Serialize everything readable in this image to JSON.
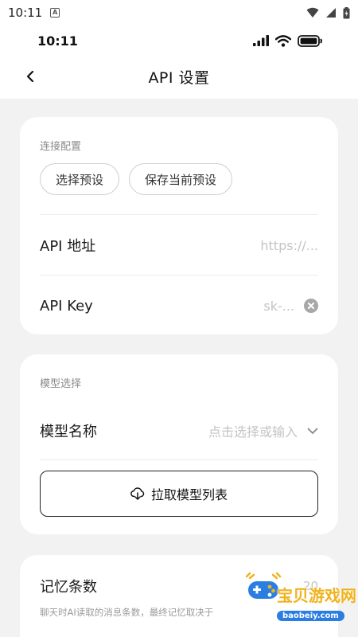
{
  "android_status": {
    "time": "10:11"
  },
  "ios_status": {
    "time": "10:11"
  },
  "header": {
    "title": "API 设置"
  },
  "connection": {
    "section_label": "连接配置",
    "preset_select_label": "选择预设",
    "preset_save_label": "保存当前预设",
    "api_url": {
      "label": "API 地址",
      "placeholder": "https://..."
    },
    "api_key": {
      "label": "API Key",
      "placeholder": "sk-..."
    }
  },
  "model": {
    "section_label": "模型选择",
    "name_label": "模型名称",
    "name_placeholder": "点击选择或输入",
    "fetch_button_label": "拉取模型列表"
  },
  "memory": {
    "title": "记忆条数",
    "description": "聊天时AI读取的消息条数，最终记忆取决于",
    "value": "20"
  },
  "watermark": {
    "text": "宝贝游戏网",
    "url": "baobeiy.com"
  },
  "icons": {
    "back": "chevron-left-icon",
    "clear": "clear-circle-icon",
    "dropdown": "chevron-down-icon",
    "cloud": "cloud-download-icon"
  },
  "colors": {
    "background": "#f2f2f2",
    "card": "#ffffff",
    "placeholder": "#c4c4c4",
    "watermark": "#f0b31e"
  }
}
